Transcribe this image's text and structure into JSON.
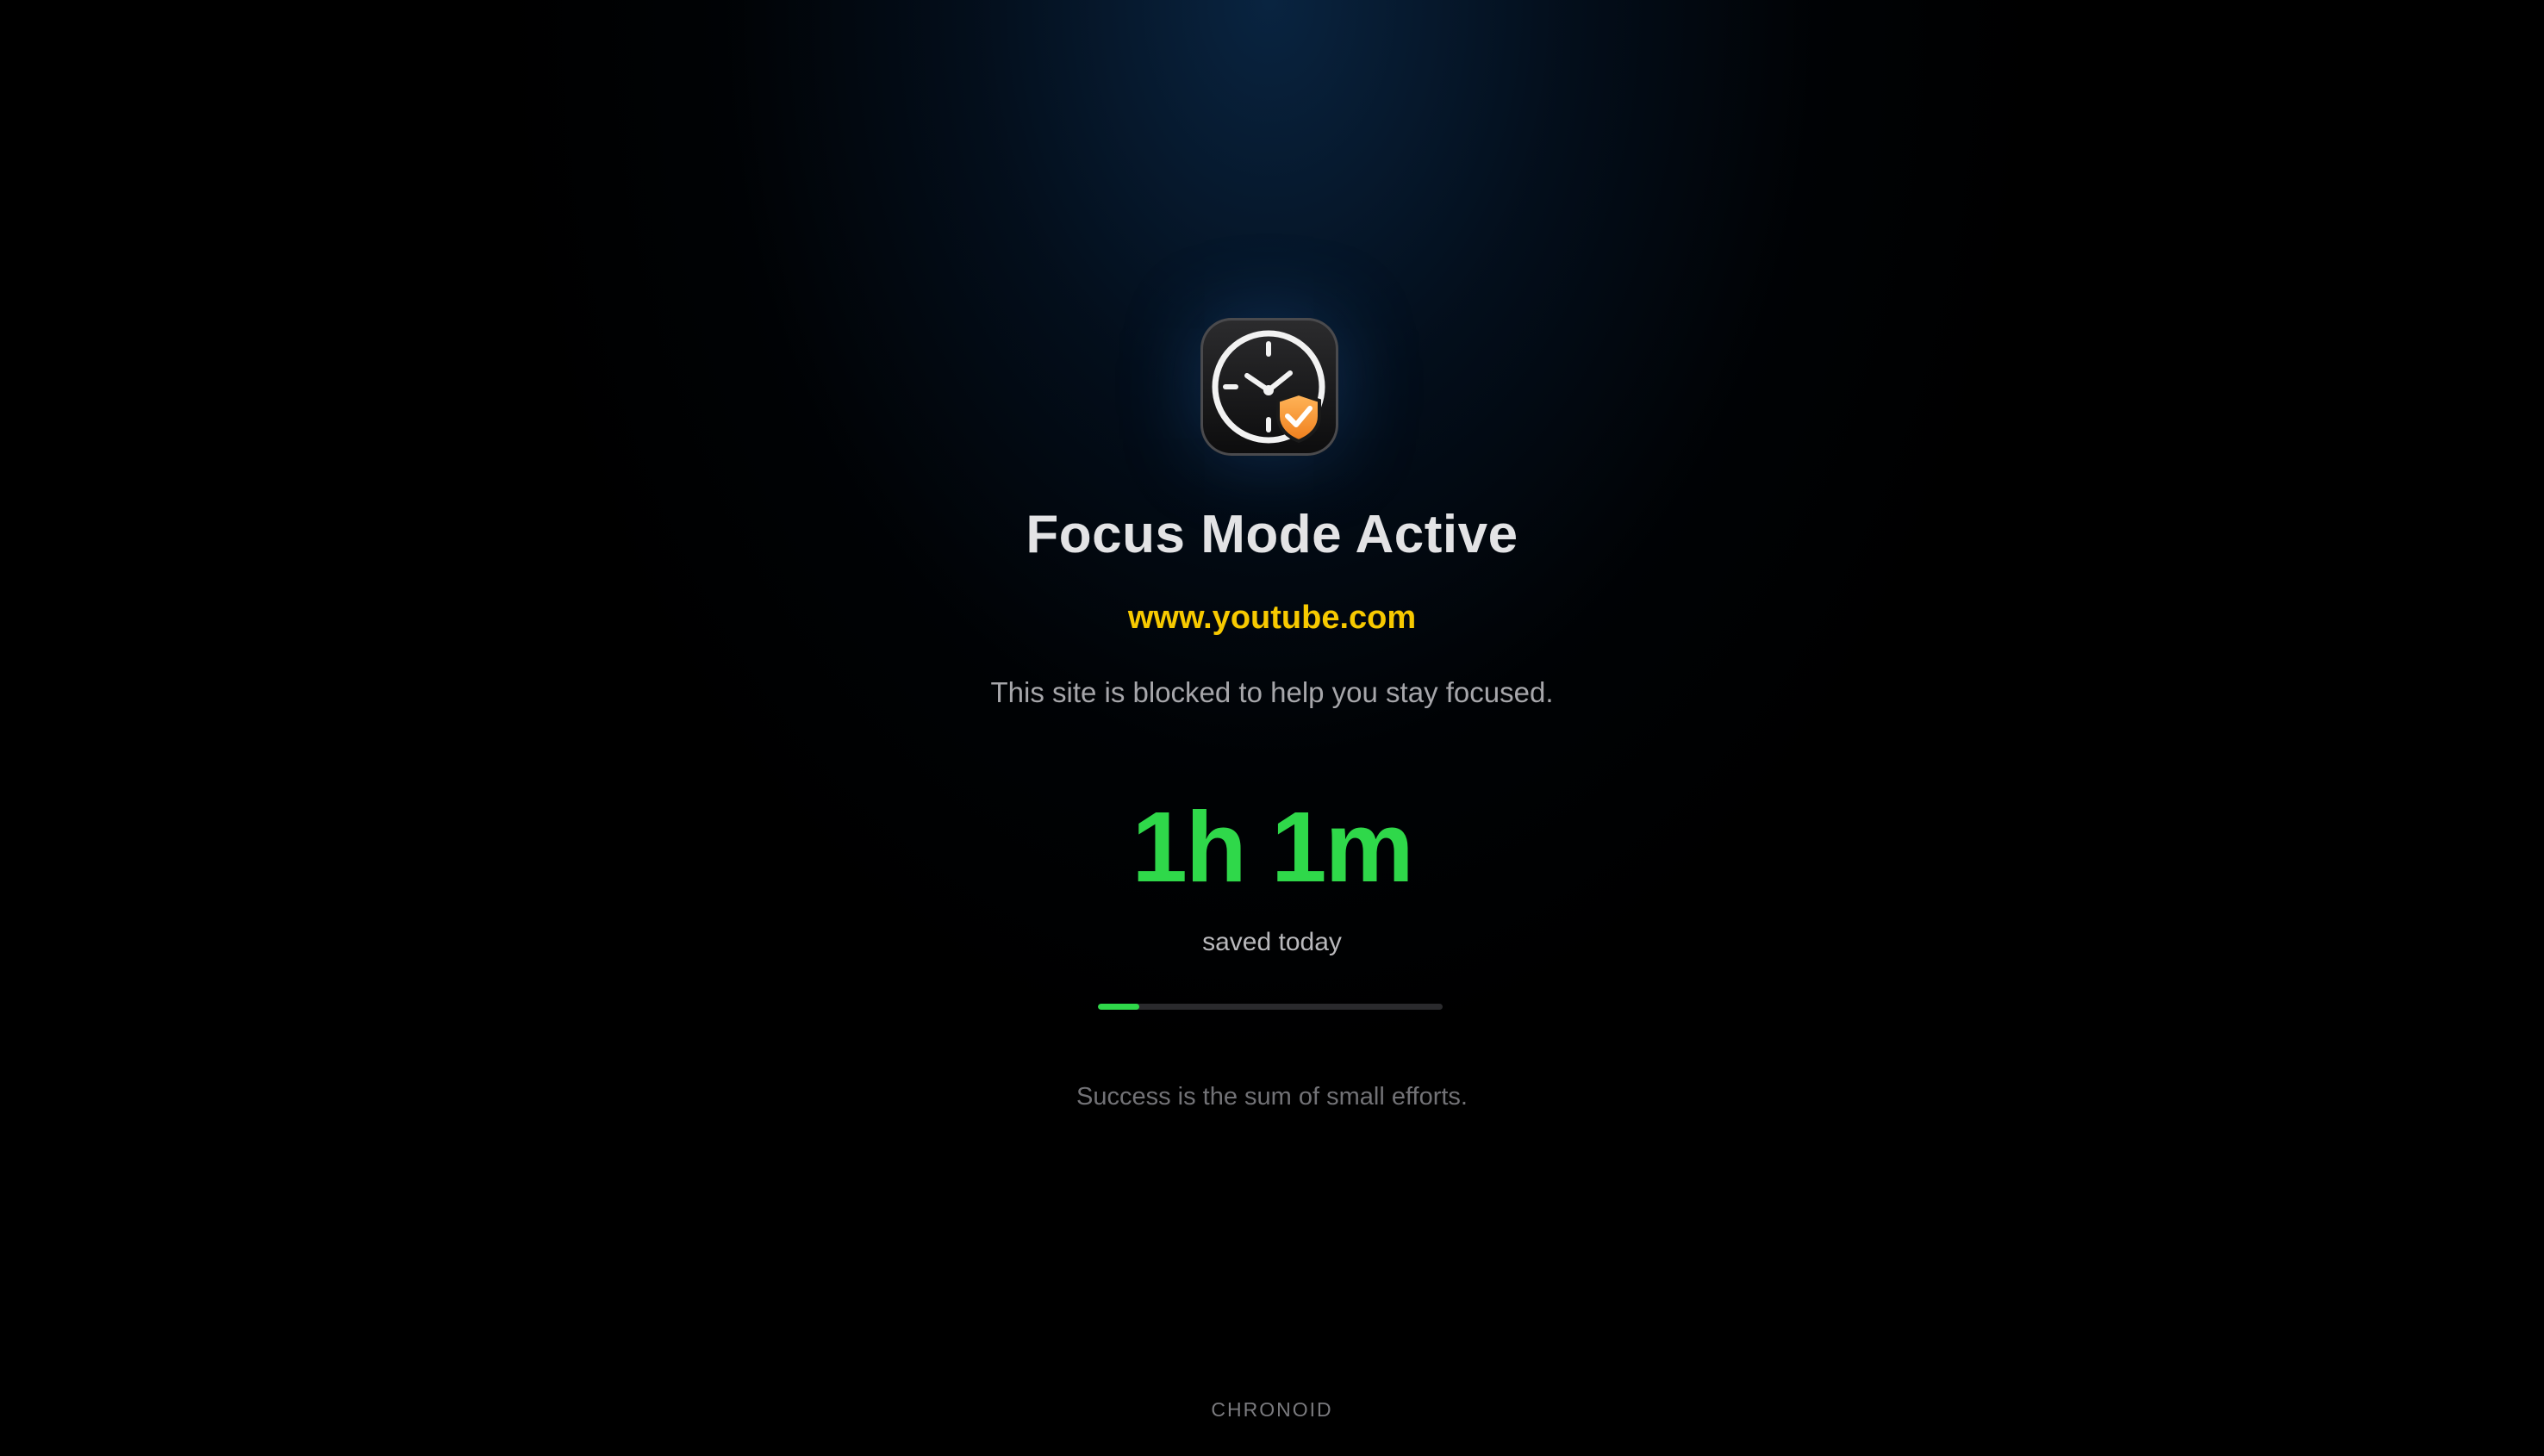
{
  "header": {
    "icon": "clock-shield-check-icon",
    "title": "Focus Mode Active",
    "blocked_site": "www.youtube.com",
    "message": "This site is blocked to help you stay focused."
  },
  "stats": {
    "saved_time": "1h 1m",
    "saved_label": "saved today",
    "progress_percent": 12
  },
  "quote": "Success is the sum of small efforts.",
  "footer": {
    "brand": "CHRONOID"
  },
  "colors": {
    "accent_green": "#2fd84a",
    "site_yellow": "#f7c900",
    "shield_orange": "#f39a2a",
    "background": "#000000"
  }
}
